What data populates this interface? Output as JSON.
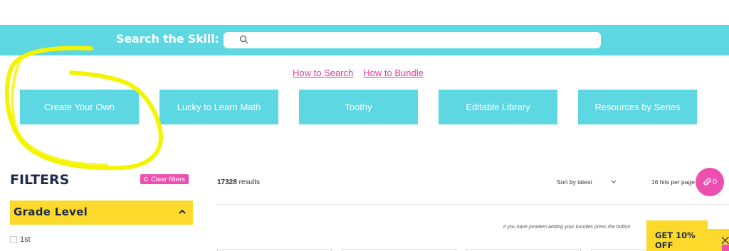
{
  "search": {
    "label": "Search the Skill:",
    "value": "",
    "placeholder": ""
  },
  "help_links": {
    "how_to_search": "How to Search",
    "how_to_bundle": "How to Bundle"
  },
  "categories": [
    "Create Your Own",
    "Lucky to Learn Math",
    "Toothy",
    "Editable Library",
    "Resources by Series"
  ],
  "filters": {
    "title": "FILTERS",
    "clear_label": "Clear filters",
    "grade_level_label": "Grade Level",
    "grade_options": [
      "1st"
    ]
  },
  "results": {
    "count": "17328",
    "suffix": " results",
    "sort_label": "Sort by latest",
    "hits_label": "16 hits per page",
    "bundle_note": "if you have problem adding your bundles press the button"
  },
  "bundle_fab": {
    "count": "0"
  },
  "discount": {
    "label": "GET 10% OFF"
  },
  "colors": {
    "accent_teal": "#5dd8e3",
    "accent_pink": "#ec4fb0",
    "accent_yellow": "#fcd92b",
    "navy": "#1e2a4a",
    "annotation_yellow": "#f4f400"
  },
  "icons": {
    "search": "search-icon",
    "chevron": "chevron-up-icon",
    "clear": "refresh-icon",
    "bundle": "paperclip-icon",
    "close": "close-icon"
  }
}
